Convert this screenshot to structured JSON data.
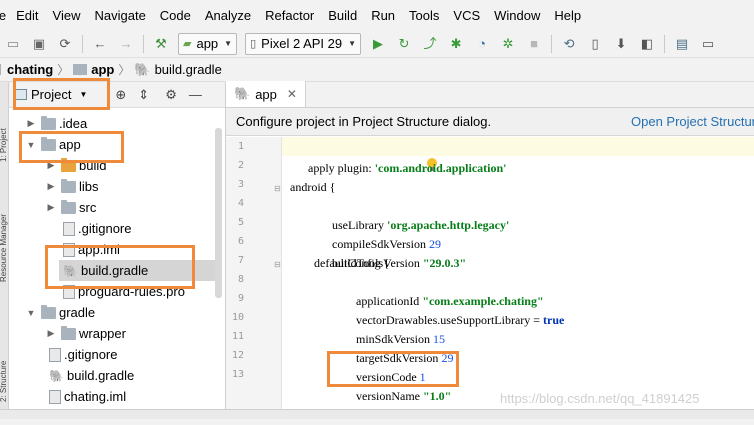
{
  "menubar": [
    "le",
    "Edit",
    "View",
    "Navigate",
    "Code",
    "Analyze",
    "Refactor",
    "Build",
    "Run",
    "Tools",
    "VCS",
    "Window",
    "Help"
  ],
  "toolbar": {
    "run_config": "app",
    "device": "Pixel 2 API 29"
  },
  "breadcrumb": {
    "items": [
      "chating",
      "app",
      "build.gradle"
    ]
  },
  "left_tool_tabs": [
    "1: Project",
    "Resource Manager",
    "2: Structure"
  ],
  "project_panel": {
    "view_selector": "Project",
    "tree": [
      {
        "label": ".idea",
        "type": "folder"
      },
      {
        "label": "app",
        "type": "module"
      },
      {
        "label": "build",
        "type": "folder-orange"
      },
      {
        "label": "libs",
        "type": "folder"
      },
      {
        "label": "src",
        "type": "folder"
      },
      {
        "label": ".gitignore",
        "type": "file"
      },
      {
        "label": "app.iml",
        "type": "file"
      },
      {
        "label": "build.gradle",
        "type": "gradle"
      },
      {
        "label": "proguard-rules.pro",
        "type": "file"
      },
      {
        "label": "gradle",
        "type": "folder"
      },
      {
        "label": "wrapper",
        "type": "folder"
      },
      {
        "label": ".gitignore",
        "type": "file"
      },
      {
        "label": "build.gradle",
        "type": "gradle"
      },
      {
        "label": "chating.iml",
        "type": "file"
      }
    ]
  },
  "editor": {
    "tab_label": "app",
    "banner_text": "Configure project in Project Structure dialog.",
    "banner_link": "Open Project Structur",
    "line_numbers": [
      "1",
      "2",
      "3",
      "4",
      "5",
      "6",
      "7",
      "8",
      "9",
      "10",
      "11",
      "12",
      "13"
    ],
    "code": {
      "l1a": "apply ",
      "l1b": "plugin",
      "l1c": ": ",
      "l1d": "'com.android.application'",
      "l3": "android {",
      "l4a": "useLibrary ",
      "l4b": "'org.apache.http.legacy'",
      "l5a": "compileSdkVersion ",
      "l5b": "29",
      "l6a": "buildToolsVersion ",
      "l6b": "\"29.0.3\"",
      "l7": "defaultConfig {",
      "l8a": "applicationId ",
      "l8b": "\"com.example.chating\"",
      "l9a": "vectorDrawables.useSupportLibrary = ",
      "l9b": "true",
      "l10a": "minSdkVersion ",
      "l10b": "15",
      "l11a": "targetSdkVersion ",
      "l11b": "29",
      "l12a": "versionCode ",
      "l12b": "1",
      "l13a": "versionName ",
      "l13b": "\"1.0\""
    }
  },
  "watermark": "https://blog.csdn.net/qq_41891425",
  "colors": {
    "highlight": "#ef8a3a",
    "link": "#2470b3",
    "string": "#067d17",
    "number": "#1750eb"
  }
}
